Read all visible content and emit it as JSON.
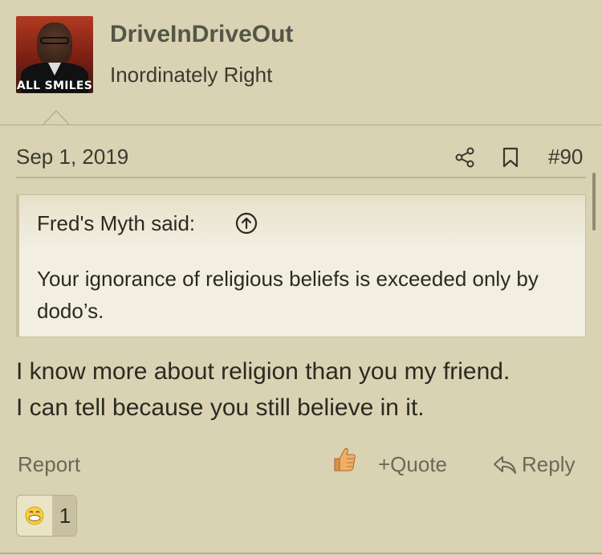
{
  "user": {
    "name": "DriveInDriveOut",
    "title": "Inordinately Right",
    "avatar_badge": "ALL SMILES"
  },
  "post": {
    "date": "Sep 1, 2019",
    "number": "#90",
    "quote": {
      "author": "Fred's Myth said:",
      "text": "Your ignorance of religious beliefs is exceeded only by dodo’s."
    },
    "body_line1": "I know more about religion than you my friend.",
    "body_line2": "I can tell because you still believe in it."
  },
  "actions": {
    "report": "Report",
    "quote": "+Quote",
    "reply": "Reply"
  },
  "reactions": {
    "count": "1",
    "icon": "grinning-emoji-icon"
  },
  "icons": [
    "share-icon",
    "bookmark-icon",
    "arrow-up-circle-icon",
    "thumbs-up-icon",
    "reply-arrow-icon"
  ],
  "colors": {
    "background": "#d9d3b3",
    "quote_bg": "#f2efe2",
    "muted_text": "#6a6958"
  }
}
